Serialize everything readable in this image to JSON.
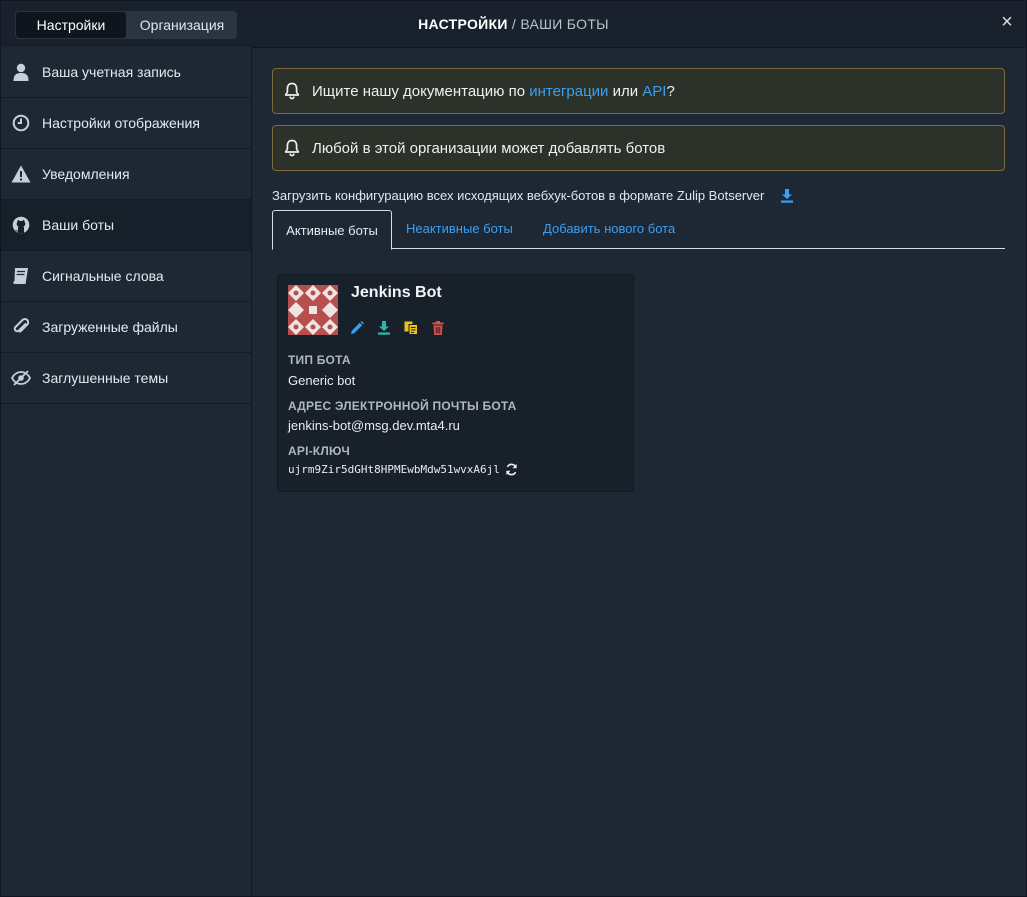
{
  "header": {
    "switch": {
      "settings": "Настройки",
      "organization": "Организация"
    },
    "title_strong": "НАСТРОЙКИ",
    "title_sep": " / ",
    "title_sub": "ВАШИ БОТЫ",
    "close": "×"
  },
  "sidebar": {
    "items": [
      {
        "label": "Ваша учетная запись",
        "icon": "user-icon"
      },
      {
        "label": "Настройки отображения",
        "icon": "clock-icon"
      },
      {
        "label": "Уведомления",
        "icon": "warning-icon"
      },
      {
        "label": "Ваши боты",
        "icon": "github-icon"
      },
      {
        "label": "Сигнальные слова",
        "icon": "book-icon"
      },
      {
        "label": "Загруженные файлы",
        "icon": "paperclip-icon"
      },
      {
        "label": "Заглушенные темы",
        "icon": "eye-slash-icon"
      }
    ],
    "selected_index": 3
  },
  "alerts": {
    "docs": {
      "before": "Ищите нашу документацию по ",
      "link1": "интеграции",
      "middle": " или ",
      "link2": "API",
      "after": "?"
    },
    "anyone": "Любой в этой организации может добавлять ботов"
  },
  "download": {
    "text": "Загрузить конфигурацию всех исходящих вебхук-ботов в формате Zulip Botserver"
  },
  "tabs": {
    "active": "Активные боты",
    "inactive": "Неактивные боты",
    "add": "Добавить нового бота"
  },
  "bot": {
    "name": "Jenkins Bot",
    "type_label": "ТИП БОТА",
    "type_value": "Generic bot",
    "email_label": "АДРЕС ЭЛЕКТРОННОЙ ПОЧТЫ БОТА",
    "email_value": "jenkins-bot@msg.dev.mta4.ru",
    "api_label": "API-КЛЮЧ",
    "api_value": "ujrm9Zir5dGHt8HPMEwbMdw51wvxA6jl"
  },
  "colors": {
    "link": "#3a9ff0",
    "accent_teal": "#2fb8a6",
    "accent_yellow": "#e8c21a",
    "delete_red": "#d9534f"
  }
}
